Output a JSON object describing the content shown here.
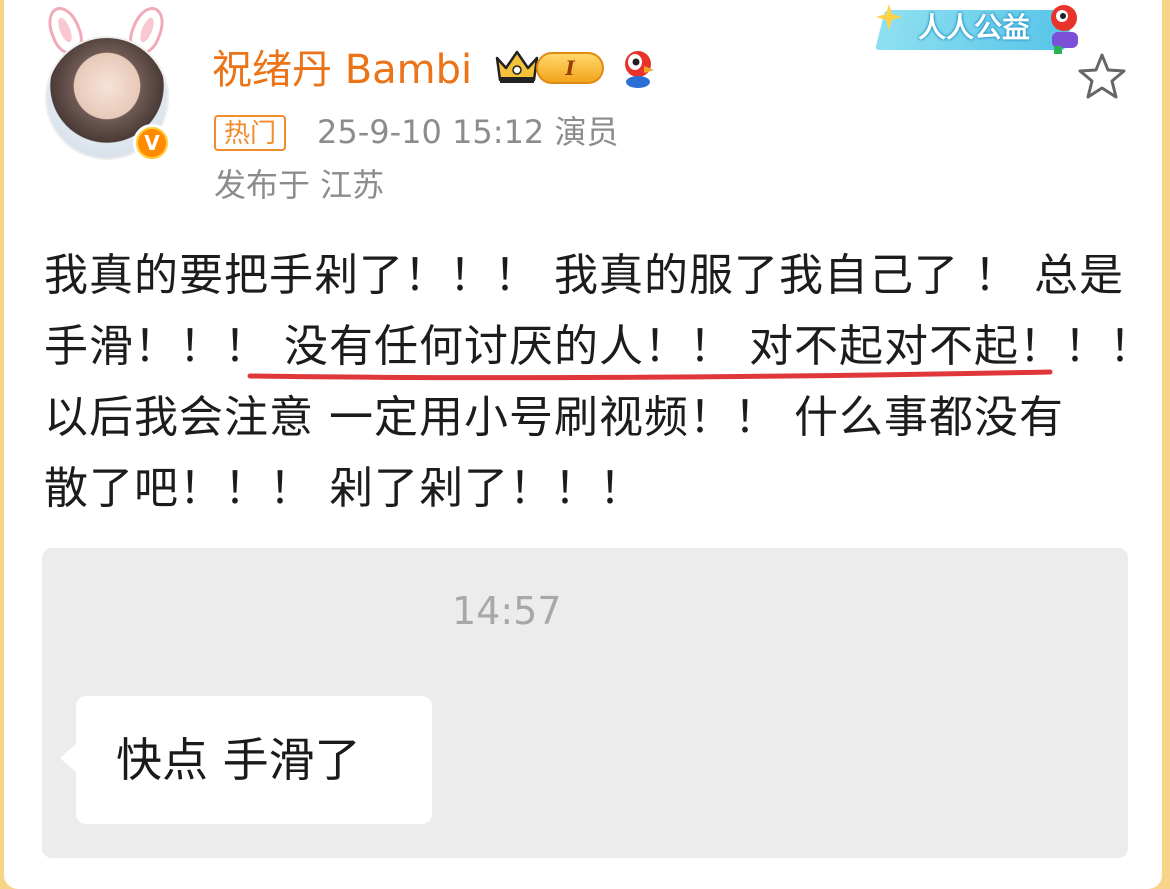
{
  "header": {
    "username": "祝绪丹 Bambi",
    "level_badge": "I",
    "hot_tag": "热门",
    "time_and_role": "25-9-10 15:12  演员",
    "location": "发布于 江苏",
    "verified_badge": "V",
    "charity_banner": "人人公益",
    "icons": {
      "favorite": "star-outline-icon",
      "crown": "crown-icon",
      "mascot": "weibo-mascot-icon"
    }
  },
  "post": {
    "lines": [
      "我真的要把手剁了！！！ 我真的服了我自己了 ！ 总是",
      "手滑！！！ ",
      "没有任何讨厌的人！！ 对不起对不起！！！",
      "以后我会注意 一定用小号刷视频！！ 什么事都没有",
      "散了吧！！！ 剁了剁了！！！"
    ],
    "underline_color": "#e0383a"
  },
  "chat_screenshot": {
    "time": "14:57",
    "message": "快点 手滑了"
  },
  "colors": {
    "username": "#eb7318",
    "meta": "#8c8c8c",
    "hot_tag": "#f08b2e",
    "page_border": "#f7d487"
  }
}
